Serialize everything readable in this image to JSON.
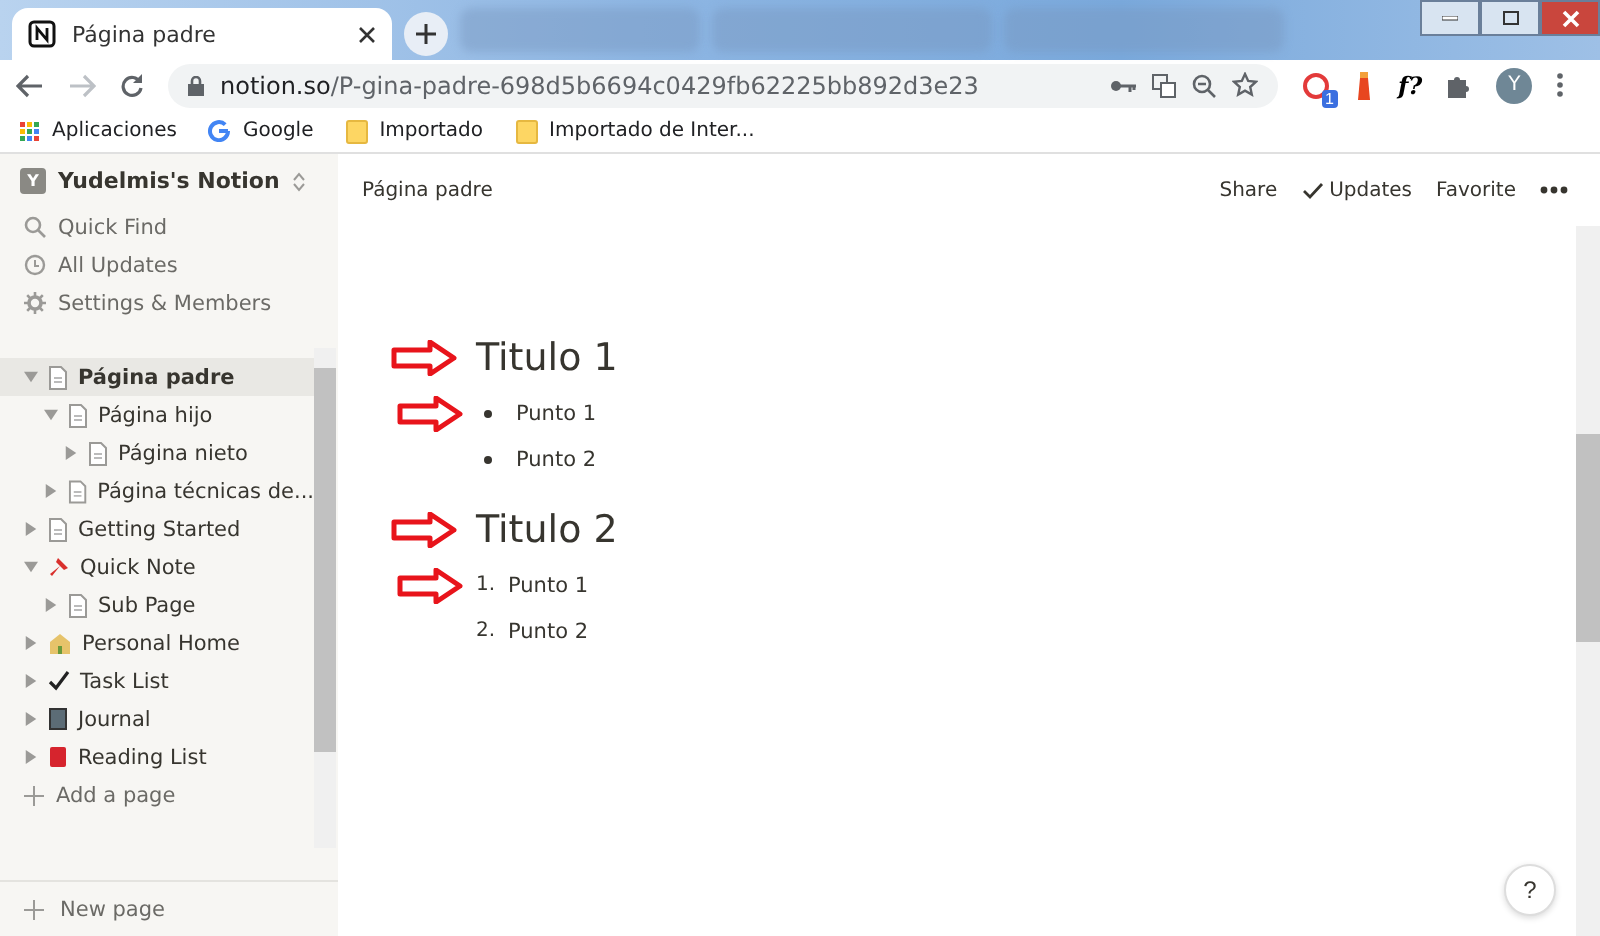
{
  "browser": {
    "tab": {
      "title": "Página padre",
      "selected": true
    },
    "url": {
      "host": "notion.so",
      "path": "/P-gina-padre-698d5b6694c0429fb62225bb892d3e23"
    },
    "extension_badge": "1",
    "extension_text": "f?",
    "profile_initial": "Y",
    "bookmarks": [
      {
        "kind": "apps",
        "label": "Aplicaciones"
      },
      {
        "kind": "google",
        "label": "Google"
      },
      {
        "kind": "folder",
        "label": "Importado"
      },
      {
        "kind": "folder",
        "label": "Importado de Inter..."
      }
    ]
  },
  "sidebar": {
    "workspace": {
      "initial": "Y",
      "name": "Yudelmis's Notion"
    },
    "nav": [
      {
        "kind": "search",
        "label": "Quick Find"
      },
      {
        "kind": "clock",
        "label": "All Updates"
      },
      {
        "kind": "gear",
        "label": "Settings & Members"
      }
    ],
    "pages": [
      {
        "label": "Página padre",
        "kind": "page",
        "expanded": true,
        "selected": true,
        "children": [
          {
            "label": "Página hijo",
            "kind": "page",
            "expanded": true,
            "selected": false,
            "children": [
              {
                "label": "Página nieto",
                "kind": "page",
                "expanded": false,
                "selected": false
              }
            ]
          },
          {
            "label": "Página técnicas de...",
            "kind": "page",
            "expanded": false,
            "selected": false
          }
        ]
      },
      {
        "label": "Getting Started",
        "kind": "page",
        "expanded": false,
        "selected": false
      },
      {
        "label": "Quick Note",
        "kind": "pin",
        "expanded": true,
        "selected": false,
        "children": [
          {
            "label": "Sub Page",
            "kind": "page",
            "expanded": false,
            "selected": false
          }
        ]
      },
      {
        "label": "Personal Home",
        "kind": "house",
        "expanded": false,
        "selected": false
      },
      {
        "label": "Task List",
        "kind": "check",
        "expanded": false,
        "selected": false
      },
      {
        "label": "Journal",
        "kind": "notebook",
        "expanded": false,
        "selected": false
      },
      {
        "label": "Reading List",
        "kind": "book",
        "expanded": false,
        "selected": false
      }
    ],
    "add_page": "Add a page",
    "new_page": "New page"
  },
  "topbar": {
    "breadcrumb": "Página padre",
    "actions": [
      {
        "kind": "text",
        "label": "Share"
      },
      {
        "kind": "check",
        "label": "Updates"
      },
      {
        "kind": "text",
        "label": "Favorite"
      },
      {
        "kind": "more"
      }
    ]
  },
  "blocks": [
    {
      "kind": "heading",
      "text": "Titulo 1",
      "arrow": true
    },
    {
      "kind": "bullet",
      "text": "Punto 1",
      "arrow": true
    },
    {
      "kind": "bullet",
      "text": "Punto 2",
      "arrow": false
    },
    {
      "kind": "heading",
      "text": "Titulo 2",
      "arrow": true
    },
    {
      "kind": "numbered",
      "marker": "1.",
      "text": "Punto 1",
      "arrow": true
    },
    {
      "kind": "numbered",
      "marker": "2.",
      "text": "Punto 2",
      "arrow": false
    }
  ],
  "help": "?"
}
